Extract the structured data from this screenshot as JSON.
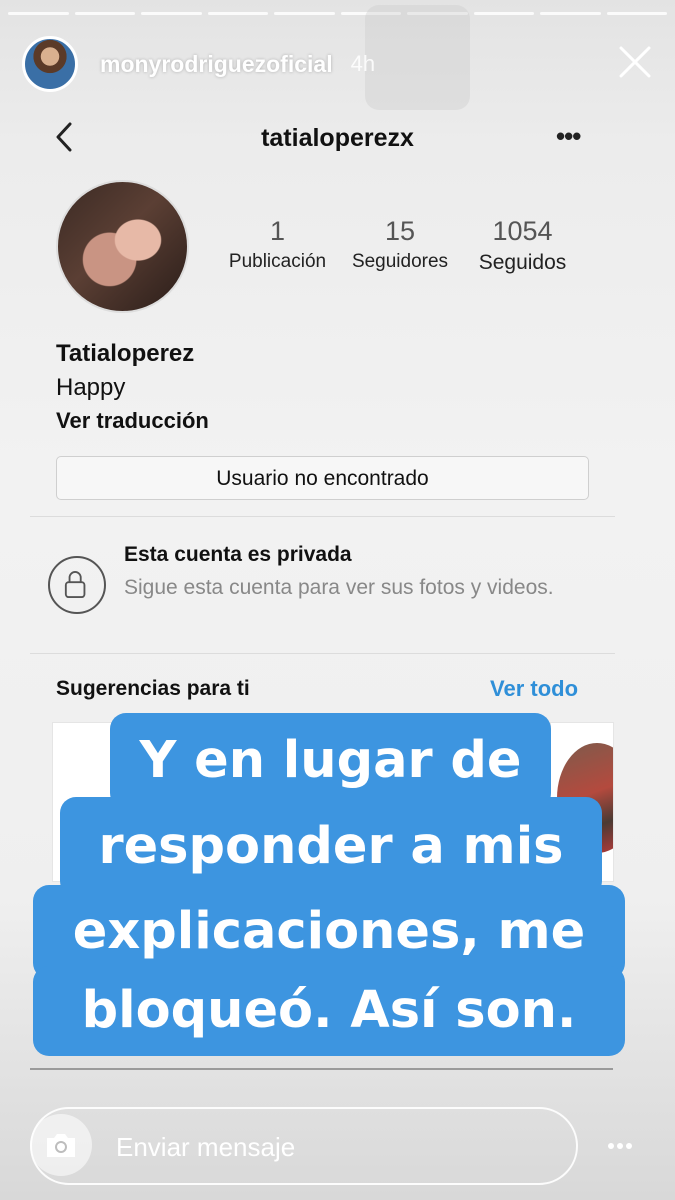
{
  "story": {
    "username": "monyrodriguezoficial",
    "time": "4h",
    "progress_segments": 10
  },
  "profile": {
    "username": "tatialoperezx",
    "stats": [
      {
        "value": "1",
        "label": "Publicación"
      },
      {
        "value": "15",
        "label": "Seguidores"
      },
      {
        "value": "1054",
        "label": "Seguidos"
      }
    ],
    "name": "Tatialoperez",
    "bio": "Happy",
    "translate_link": "Ver traducción",
    "status_button": "Usuario no encontrado",
    "private_title": "Esta cuenta es privada",
    "private_subtitle": "Sigue esta cuenta para ver sus fotos y videos.",
    "suggestions_label": "Sugerencias para ti",
    "see_all": "Ver todo"
  },
  "caption": {
    "line1": "Y en lugar de",
    "line2": "responder a mis",
    "line3": "explicaciones, me",
    "line4": "bloqueó. Así son."
  },
  "footer": {
    "message_placeholder": "Enviar mensaje"
  },
  "colors": {
    "caption_bg": "#3d95e0",
    "link": "#2f8fd8"
  }
}
